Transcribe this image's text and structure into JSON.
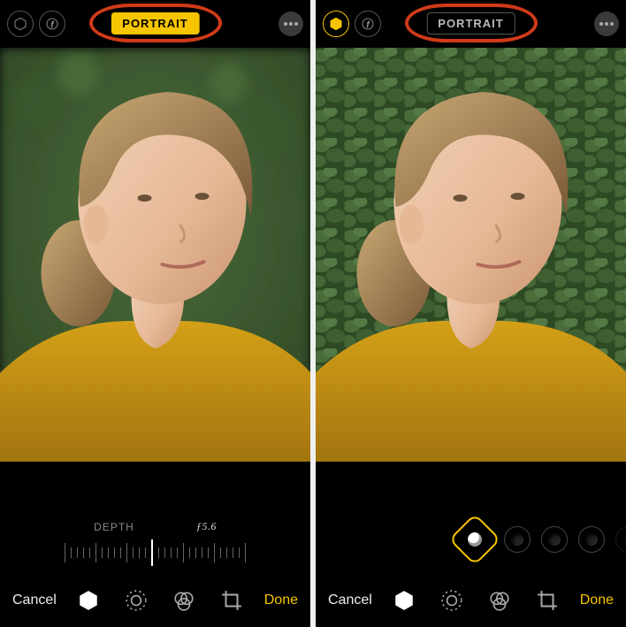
{
  "colors": {
    "accent": "#f7c400",
    "annotation": "#d03a1a"
  },
  "left": {
    "portrait_badge": "PORTRAIT",
    "portrait_active": true,
    "depth_label": "DEPTH",
    "depth_value": "ƒ5.6",
    "cancel": "Cancel",
    "done": "Done",
    "active_tool": "lighting"
  },
  "right": {
    "portrait_badge": "PORTRAIT",
    "portrait_active": false,
    "cancel": "Cancel",
    "done": "Done",
    "active_tool": "lighting",
    "lighting_options": [
      "natural",
      "studio",
      "contour",
      "stage",
      "mono"
    ],
    "selected_lighting": "natural"
  },
  "toolbar_icons": [
    "lighting",
    "adjust",
    "filters",
    "crop"
  ]
}
